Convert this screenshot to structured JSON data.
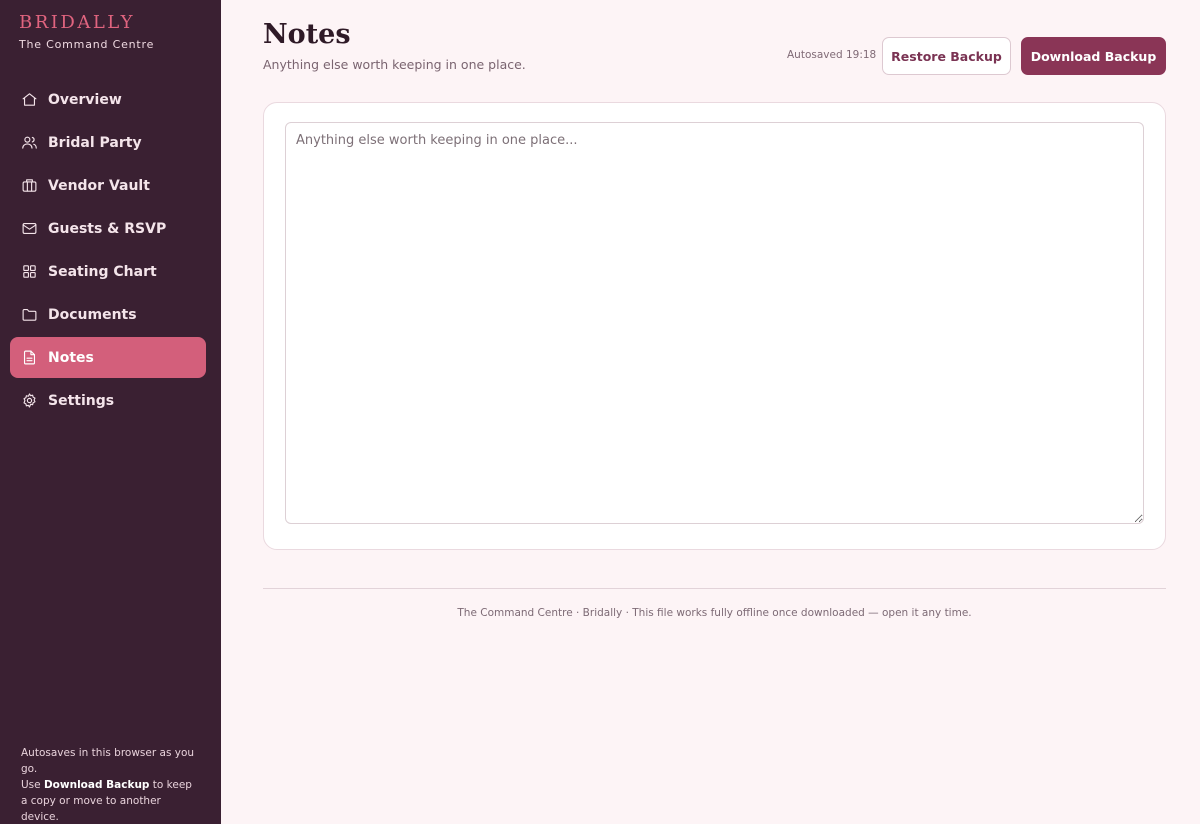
{
  "brand": {
    "name": "BRIDALLY",
    "subtitle": "The Command Centre"
  },
  "sidebar": {
    "items": [
      {
        "label": "Overview",
        "icon": "home-icon",
        "active": false
      },
      {
        "label": "Bridal Party",
        "icon": "users-icon",
        "active": false
      },
      {
        "label": "Vendor Vault",
        "icon": "briefcase-icon",
        "active": false
      },
      {
        "label": "Guests & RSVP",
        "icon": "mail-icon",
        "active": false
      },
      {
        "label": "Seating Chart",
        "icon": "grid-icon",
        "active": false
      },
      {
        "label": "Documents",
        "icon": "folder-icon",
        "active": false
      },
      {
        "label": "Notes",
        "icon": "file-text-icon",
        "active": true
      },
      {
        "label": "Settings",
        "icon": "gear-icon",
        "active": false
      }
    ],
    "footer": {
      "line1": "Autosaves in this browser as you go.",
      "line2_prefix": "Use ",
      "line2_bold": "Download Backup",
      "line2_suffix": " to keep a copy or move to another device."
    }
  },
  "header": {
    "title": "Notes",
    "subtitle": "Anything else worth keeping in one place.",
    "autosave": "Autosaved 19:18",
    "restore_label": "Restore Backup",
    "download_label": "Download Backup"
  },
  "notes": {
    "value": "",
    "placeholder": "Anything else worth keeping in one place..."
  },
  "footer": {
    "text": "The Command Centre · Bridally · This file works fully offline once downloaded — open it any time."
  },
  "colors": {
    "sidebar_bg": "#3a2032",
    "accent": "#d35f7b",
    "brand": "#e0647f",
    "primary_button": "#8a3556",
    "page_bg": "#fdf4f6"
  }
}
